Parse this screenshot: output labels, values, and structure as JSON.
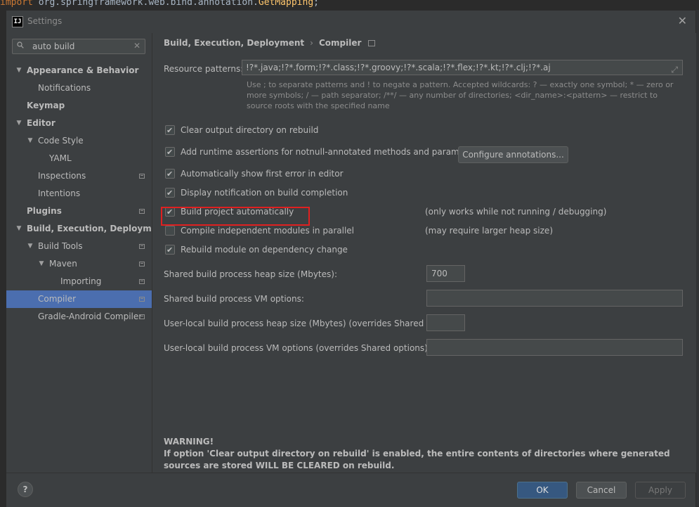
{
  "background": {
    "code_line": {
      "kw": "import",
      "pkg": " org.springframework.web.bind.annotation.",
      "fn": "GetMapping",
      "end": ";"
    }
  },
  "window": {
    "icon_text": "IJ",
    "title": "Settings",
    "close_glyph": "✕"
  },
  "search": {
    "value": "auto build",
    "clear_glyph": "✕"
  },
  "tree": [
    {
      "label": "Appearance & Behavior",
      "level": 0,
      "expanded": true,
      "bold": true,
      "has_page_icon": false
    },
    {
      "label": "Notifications",
      "level": 1,
      "bold": false
    },
    {
      "label": "Keymap",
      "level": 0,
      "bold": true
    },
    {
      "label": "Editor",
      "level": 0,
      "expanded": true,
      "bold": true
    },
    {
      "label": "Code Style",
      "level": 1,
      "expanded": true
    },
    {
      "label": "YAML",
      "level": 2
    },
    {
      "label": "Inspections",
      "level": 1,
      "has_page_icon": true
    },
    {
      "label": "Intentions",
      "level": 1
    },
    {
      "label": "Plugins",
      "level": 0,
      "bold": true,
      "has_page_icon": true
    },
    {
      "label": "Build, Execution, Deployment",
      "level": 0,
      "expanded": true,
      "bold": true
    },
    {
      "label": "Build Tools",
      "level": 1,
      "expanded": true,
      "has_page_icon": true
    },
    {
      "label": "Maven",
      "level": 2,
      "expanded": true,
      "has_page_icon": true
    },
    {
      "label": "Importing",
      "level": 3,
      "has_page_icon": true
    },
    {
      "label": "Compiler",
      "level": 1,
      "selected": true,
      "has_page_icon": true
    },
    {
      "label": "Gradle-Android Compiler",
      "level": 1,
      "has_page_icon": true
    }
  ],
  "breadcrumb": {
    "parent": "Build, Execution, Deployment",
    "separator": "›",
    "current": "Compiler"
  },
  "resource_patterns": {
    "label": "Resource patterns:",
    "value": "!?*.java;!?*.form;!?*.class;!?*.groovy;!?*.scala;!?*.flex;!?*.kt;!?*.clj;!?*.aj",
    "expand_glyph": "⤢",
    "hint": "Use ; to separate patterns and ! to negate a pattern. Accepted wildcards: ? — exactly one symbol; * — zero or more symbols; / — path separator; /**/ — any number of directories; <dir_name>:<pattern> — restrict to source roots with the specified name"
  },
  "options": [
    {
      "label": "Clear output directory on rebuild",
      "checked": true
    },
    {
      "label": "Add runtime assertions for notnull-annotated methods and parameters",
      "checked": true
    },
    {
      "label": "Automatically show first error in editor",
      "checked": true
    },
    {
      "label": "Display notification on build completion",
      "checked": true
    },
    {
      "label": "Build project automatically",
      "checked": true,
      "note": "(only works while not running / debugging)"
    },
    {
      "label": "Compile independent modules in parallel",
      "checked": false,
      "note": "(may require larger heap size)"
    },
    {
      "label": "Rebuild module on dependency change",
      "checked": true
    }
  ],
  "configure_annotations_label": "Configure annotations...",
  "fields": {
    "heap_label": "Shared build process heap size (Mbytes):",
    "heap_value": "700",
    "vm_label": "Shared build process VM options:",
    "vm_value": "",
    "local_heap_label": "User-local build process heap size (Mbytes) (overrides Shared size):",
    "local_heap_value": "",
    "local_vm_label": "User-local build process VM options (overrides Shared options):",
    "local_vm_value": ""
  },
  "warning": {
    "title": "WARNING!",
    "text": "If option 'Clear output directory on rebuild' is enabled, the entire contents of directories where generated sources are stored WILL BE CLEARED on rebuild."
  },
  "footer": {
    "help": "?",
    "ok": "OK",
    "cancel": "Cancel",
    "apply": "Apply"
  },
  "colors": {
    "selection": "#4b6eaf",
    "highlight_box": "#e02020",
    "ok_button": "#365880"
  }
}
